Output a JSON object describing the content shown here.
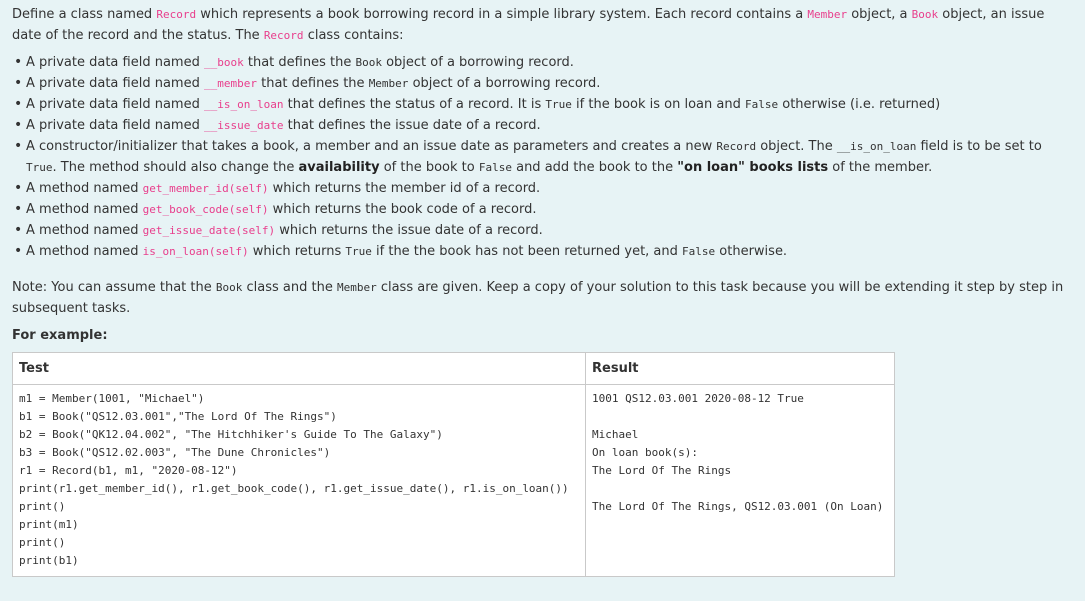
{
  "intro": {
    "t1": "Define a class named ",
    "c1": "Record",
    "t2": " which represents a book borrowing record in a simple library system. Each record contains a ",
    "c2": "Member",
    "t3": " object, a ",
    "c3": "Book",
    "t4": " object, an issue date of the record and the status. The ",
    "c4": "Record",
    "t5": " class contains:"
  },
  "items": [
    {
      "a": "A private data field named ",
      "b": "__book",
      "c": " that defines the ",
      "d": "Book",
      "e": " object of a borrowing record."
    },
    {
      "a": "A private data field named ",
      "b": "__member",
      "c": " that defines the ",
      "d": "Member",
      "e": " object of a borrowing record."
    },
    {
      "a": "A private data field named ",
      "b": "__is_on_loan",
      "c": " that defines the status of a record. It is ",
      "d": "True",
      "e": " if the book is on loan and ",
      "f": "False",
      "g": " otherwise (i.e. returned)"
    },
    {
      "a": "A private data field named ",
      "b": "__issue_date",
      "c": " that defines the issue date of a record."
    },
    {
      "a": "A constructor/initializer that takes a book, a member and an issue date as parameters and creates a new ",
      "b": "Record",
      "c": " object. The ",
      "d": "__is_on_loan",
      "e": " field is to be set to ",
      "f": "True",
      "g": ". The method should also change the ",
      "h": "availability",
      "i": " of the book to ",
      "j": "False",
      "k": " and add the book to the ",
      "l": "\"on loan\" books lists",
      "m": " of the member."
    },
    {
      "a": "A method named ",
      "b": "get_member_id(self)",
      "c": " which returns the member id of a record."
    },
    {
      "a": "A method named ",
      "b": "get_book_code(self)",
      "c": " which returns the book code of a record."
    },
    {
      "a": "A method named ",
      "b": "get_issue_date(self)",
      "c": " which returns the issue date of a record."
    },
    {
      "a": "A method named ",
      "b": "is_on_loan(self)",
      "c": " which returns ",
      "d": "True",
      "e": " if the the book has not been returned yet, and ",
      "f": "False",
      "g": " otherwise."
    }
  ],
  "note": {
    "a": "Note: You can assume that the ",
    "b": "Book",
    "c": " class and the ",
    "d": "Member",
    "e": " class are given. Keep a copy of your solution to this task because you will be extending it step by step in subsequent tasks."
  },
  "example_label": "For example:",
  "table": {
    "headers": [
      "Test",
      "Result"
    ],
    "test_lines": [
      "m1 = Member(1001, \"Michael\")",
      "b1 = Book(\"QS12.03.001\",\"The Lord Of The Rings\")",
      "b2 = Book(\"QK12.04.002\", \"The Hitchhiker's Guide To The Galaxy\")",
      "b3 = Book(\"QS12.02.003\", \"The Dune Chronicles\")",
      "r1 = Record(b1, m1, \"2020-08-12\")",
      "print(r1.get_member_id(), r1.get_book_code(), r1.get_issue_date(), r1.is_on_loan())",
      "print()",
      "print(m1)",
      "print()",
      "print(b1)"
    ],
    "result_lines": [
      "1001 QS12.03.001 2020-08-12 True",
      "",
      "Michael",
      "On loan book(s):",
      "The Lord Of The Rings",
      "",
      "The Lord Of The Rings, QS12.03.001 (On Loan)"
    ]
  }
}
